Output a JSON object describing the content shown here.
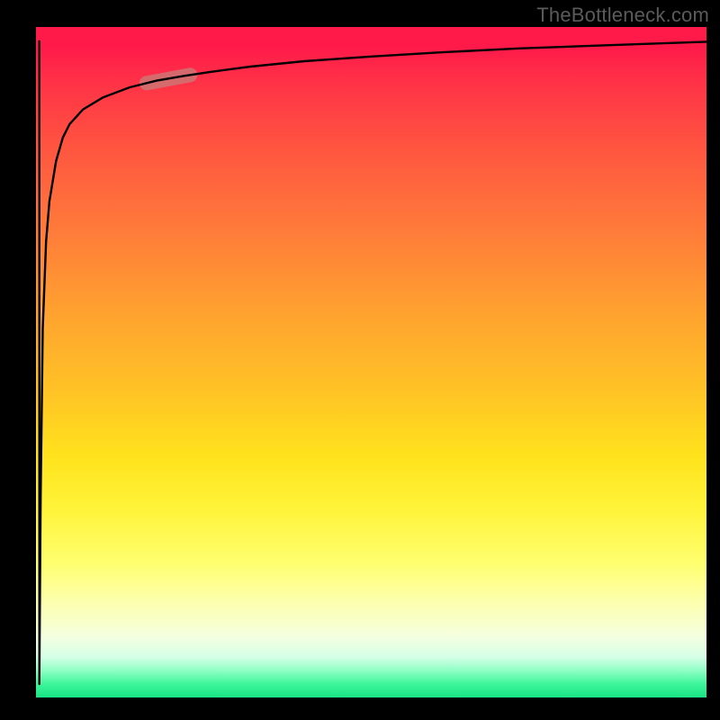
{
  "watermark": "TheBottleneck.com",
  "chart_data": {
    "type": "line",
    "title": "",
    "xlabel": "",
    "ylabel": "",
    "xlim": [
      0,
      100
    ],
    "ylim": [
      0,
      100
    ],
    "grid": false,
    "legend": false,
    "background_gradient": {
      "direction": "vertical",
      "stops": [
        {
          "pos": 0.0,
          "color": "#ff1a4a"
        },
        {
          "pos": 0.45,
          "color": "#ffb028"
        },
        {
          "pos": 0.75,
          "color": "#ffff60"
        },
        {
          "pos": 0.93,
          "color": "#e8ffd8"
        },
        {
          "pos": 1.0,
          "color": "#18e586"
        }
      ]
    },
    "series": [
      {
        "name": "curve",
        "x": [
          0.5,
          0.7,
          1.0,
          1.5,
          2.0,
          3.0,
          4.0,
          5.0,
          7.0,
          10.0,
          14.0,
          18.0,
          22.0,
          26.0,
          32.0,
          40.0,
          50.0,
          60.0,
          72.0,
          86.0,
          100.0
        ],
        "y": [
          2.0,
          30.0,
          55.0,
          68.0,
          74.0,
          80.0,
          83.5,
          85.5,
          87.7,
          89.5,
          91.0,
          92.0,
          92.7,
          93.3,
          94.1,
          94.9,
          95.6,
          96.2,
          96.8,
          97.3,
          97.8
        ]
      }
    ],
    "highlight_segment": {
      "series": "curve",
      "x_range": [
        16.5,
        23.0
      ],
      "color": "#c97b78"
    }
  }
}
